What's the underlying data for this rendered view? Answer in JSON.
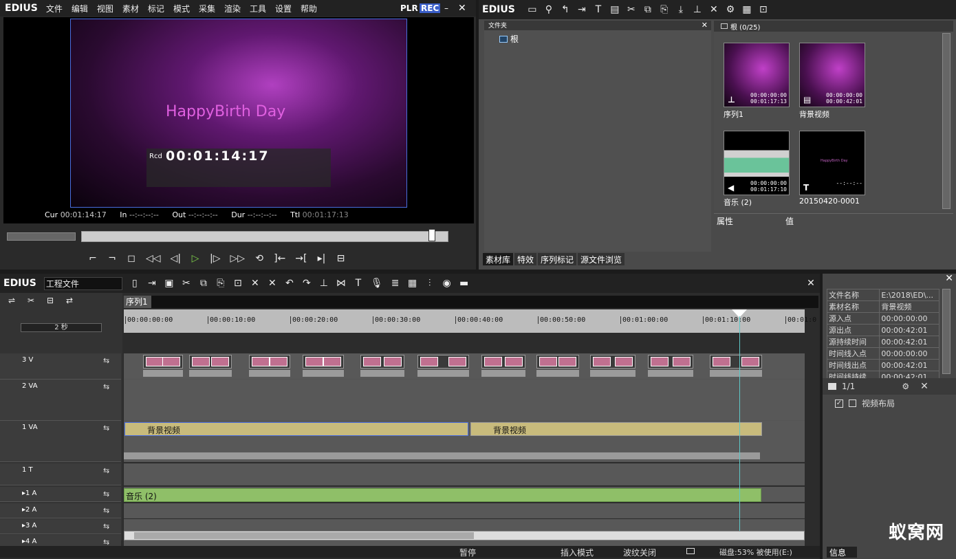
{
  "player": {
    "logo": "EDIUS",
    "menu": [
      "文件",
      "编辑",
      "视图",
      "素材",
      "标记",
      "模式",
      "采集",
      "渲染",
      "工具",
      "设置",
      "帮助"
    ],
    "plr": "PLR",
    "rec": "REC",
    "title_text": "HappyBirth Day",
    "rcd_label": "Rcd",
    "rcd_time": "00:01:14:17",
    "cur_label": "Cur",
    "cur": "00:01:14:17",
    "in_label": "In",
    "in": "--:--:--:--",
    "out_label": "Out",
    "out": "--:--:--:--",
    "dur_label": "Dur",
    "dur": "--:--:--:--",
    "ttl_label": "Ttl",
    "ttl": "00:01:17:13"
  },
  "bin": {
    "logo": "EDIUS",
    "folder_title": "文件夹",
    "root": "根",
    "root_count": "根 (0/25)",
    "prop_header": "属性",
    "value_header": "值",
    "tabs": [
      "素材库",
      "特效",
      "序列标记",
      "源文件浏览"
    ],
    "clips": [
      {
        "name": "序列1",
        "t1": "00:00:00:00",
        "t2": "00:01:17:13"
      },
      {
        "name": "背景视频",
        "t1": "00:00:00:00",
        "t2": "00:00:42:01"
      },
      {
        "name": "音乐 (2)",
        "t1": "00:00:00:00",
        "t2": "00:01:17:10"
      },
      {
        "name": "20150420-0001",
        "t1": "--:--:--",
        "t2": "",
        "inner": "HappyBirth Day"
      }
    ]
  },
  "timeline": {
    "logo": "EDIUS",
    "project": "工程文件",
    "seq_tab": "序列1",
    "zoom": "2 秒",
    "ruler": [
      "00:00:00:00",
      "00:00:10:00",
      "00:00:20:00",
      "00:00:30:00",
      "00:00:40:00",
      "00:00:50:00",
      "00:01:00:00",
      "00:01:10:00",
      "00:01:0"
    ],
    "tracks": [
      "3 V",
      "2 VA",
      "1 VA",
      "1 T",
      "▸1 A",
      "▸2 A",
      "▸3 A",
      "▸4 A"
    ],
    "clip_bg1": "背景视频",
    "clip_bg2": "背景视频",
    "clip_music": "音乐 (2)",
    "status": {
      "pause": "暂停",
      "insert": "插入模式",
      "ripple": "波纹关闭",
      "disk": "磁盘:53% 被使用(E:)"
    }
  },
  "info": {
    "rows": [
      [
        "文件名称",
        "E:\\2018\\ED\\..."
      ],
      [
        "素材名称",
        "背景视频"
      ],
      [
        "源入点",
        "00:00:00:00"
      ],
      [
        "源出点",
        "00:00:42:01"
      ],
      [
        "源持续时间",
        "00:00:42:01"
      ],
      [
        "时间线入点",
        "00:00:00:00"
      ],
      [
        "时间线出点",
        "00:00:42:01"
      ],
      [
        "时间线持续...",
        "00:00:42:01"
      ]
    ],
    "page": "1/1",
    "layout": "视频布局",
    "tab": "信息",
    "watermark": "蚁窝网"
  }
}
